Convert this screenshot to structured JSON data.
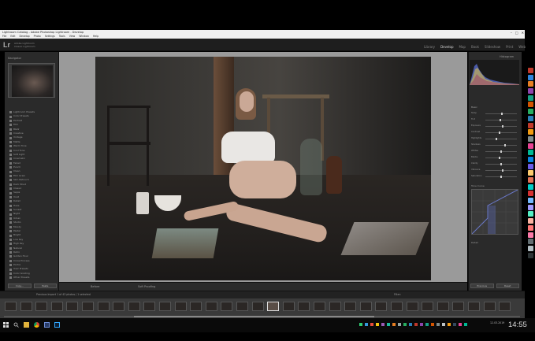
{
  "window": {
    "title": "Lightroom Catalog - Adobe Photoshop Lightroom - Develop",
    "controls": [
      "–",
      "□",
      "✕"
    ]
  },
  "menu": [
    "File",
    "Edit",
    "Develop",
    "Photo",
    "Settings",
    "Tools",
    "View",
    "Window",
    "Help"
  ],
  "app": {
    "logo": "Lr",
    "identity_line1": "Adobe Lightroom",
    "identity_line2": "Classic Lightroom"
  },
  "modules": [
    {
      "label": "Library",
      "active": false
    },
    {
      "label": "Develop",
      "active": true
    },
    {
      "label": "Map",
      "active": false
    },
    {
      "label": "Book",
      "active": false
    },
    {
      "label": "Slideshow",
      "active": false
    },
    {
      "label": "Print",
      "active": false
    },
    {
      "label": "Web",
      "active": false
    }
  ],
  "left_panel": {
    "navigator_label": "Navigator",
    "presets": [
      "Lightroom Presets",
      "Color Presets",
      "Portrait",
      "Film",
      "B&W",
      "Creative",
      "Vintage",
      "Matte",
      "Warm Tone",
      "Cool Tone",
      "Soft Light",
      "Cinematic",
      "Faded",
      "Punch",
      "Clean",
      "Film Grain",
      "Skin Retouch",
      "Dark Mood",
      "Classic",
      "Sepia",
      "Vivid",
      "Detail",
      "Haze",
      "Sunset",
      "Night",
      "Urban",
      "Studio",
      "Moody",
      "Pastel",
      "Bright",
      "Low Key",
      "High Key",
      "Natural",
      "Retro",
      "Golden Hour",
      "Cross Process",
      "Portra",
      "User Presets",
      "Color Grading",
      "Other Presets"
    ],
    "buttons": [
      "Copy...",
      "Paste"
    ],
    "bottom_label": "Snapshots"
  },
  "toolbar": {
    "view_label": "Before",
    "soft_proof": "Soft Proofing"
  },
  "right_panel": {
    "histogram_label": "Histogram",
    "basic_label": "Basic",
    "sliders": [
      {
        "label": "Temp",
        "value": 0.52
      },
      {
        "label": "Tint",
        "value": 0.48
      },
      {
        "label": "Exposure",
        "value": 0.55
      },
      {
        "label": "Contrast",
        "value": 0.45
      },
      {
        "label": "Highlights",
        "value": 0.35
      },
      {
        "label": "Shadows",
        "value": 0.62
      },
      {
        "label": "Whites",
        "value": 0.5
      },
      {
        "label": "Blacks",
        "value": 0.44
      },
      {
        "label": "Clarity",
        "value": 0.5
      },
      {
        "label": "Vibrance",
        "value": 0.56
      },
      {
        "label": "Saturation",
        "value": 0.5
      }
    ],
    "tone_curve_label": "Tone Curve",
    "detail_label": "Detail",
    "buttons": [
      "Previous",
      "Reset"
    ]
  },
  "filmstrip": {
    "source": "Previous Import  1 of 43 photos / 1 selected",
    "filter_label": "Filter:",
    "selected_index": 17,
    "thumb_count": 33,
    "scroll_position": 0.47
  },
  "desktop_icon_colors": [
    "#c0392b",
    "#2e86de",
    "#e67e22",
    "#8e44ad",
    "#16a085",
    "#d35400",
    "#27ae60",
    "#2980b9",
    "#c0392b",
    "#f39c12",
    "#7f8c8d",
    "#e84393",
    "#00b894",
    "#0984e3",
    "#6c5ce7",
    "#fdcb6e",
    "#e17055",
    "#00cec9",
    "#d63031",
    "#74b9ff",
    "#a29bfe",
    "#55efc4",
    "#fab1a0",
    "#ff7675",
    "#fd79a8",
    "#636e72",
    "#b2bec3",
    "#2d3436"
  ],
  "taskbar": {
    "icons": [
      "windows-icon",
      "search-icon",
      "task-view-icon",
      "explorer-icon",
      "chrome-icon",
      "lightroom-icon",
      "photoshop-icon"
    ],
    "clock": "14:55",
    "date": "12.03.2019"
  }
}
